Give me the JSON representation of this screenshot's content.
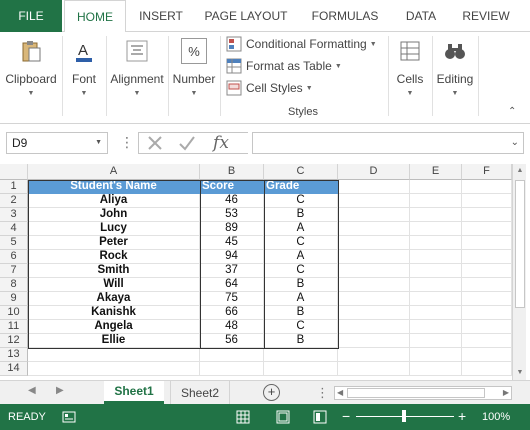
{
  "ribbon_tabs": {
    "file": "FILE",
    "home": "HOME",
    "insert": "INSERT",
    "page_layout": "PAGE LAYOUT",
    "formulas": "FORMULAS",
    "data": "DATA",
    "review": "REVIEW"
  },
  "ribbon": {
    "clipboard": "Clipboard",
    "font": "Font",
    "alignment": "Alignment",
    "number": "Number",
    "conditional_formatting": "Conditional Formatting",
    "format_as_table": "Format as Table",
    "cell_styles": "Cell Styles",
    "styles_group": "Styles",
    "cells": "Cells",
    "editing": "Editing",
    "number_icon": "%"
  },
  "formula_bar": {
    "name_box": "D9",
    "fx_label": "fx",
    "formula": ""
  },
  "columns": [
    "A",
    "B",
    "C",
    "D",
    "E",
    "F"
  ],
  "rows": [
    "1",
    "2",
    "3",
    "4",
    "5",
    "6",
    "7",
    "8",
    "9",
    "10",
    "11",
    "12",
    "13",
    "14"
  ],
  "table": {
    "headers": [
      "Student's Name",
      "Score",
      "Grade"
    ],
    "rows": [
      [
        "Aliya",
        "46",
        "C"
      ],
      [
        "John",
        "53",
        "B"
      ],
      [
        "Lucy",
        "89",
        "A"
      ],
      [
        "Peter",
        "45",
        "C"
      ],
      [
        "Rock",
        "94",
        "A"
      ],
      [
        "Smith",
        "37",
        "C"
      ],
      [
        "Will",
        "64",
        "B"
      ],
      [
        "Akaya",
        "75",
        "A"
      ],
      [
        "Kanishk",
        "66",
        "B"
      ],
      [
        "Angela",
        "48",
        "C"
      ],
      [
        "Ellie",
        "56",
        "B"
      ]
    ]
  },
  "sheets": [
    "Sheet1",
    "Sheet2"
  ],
  "status": {
    "ready": "READY",
    "zoom": "100%",
    "zoom_out": "−",
    "zoom_in": "+"
  },
  "colors": {
    "excel_green": "#217346",
    "header_blue": "#5b9bd5"
  }
}
